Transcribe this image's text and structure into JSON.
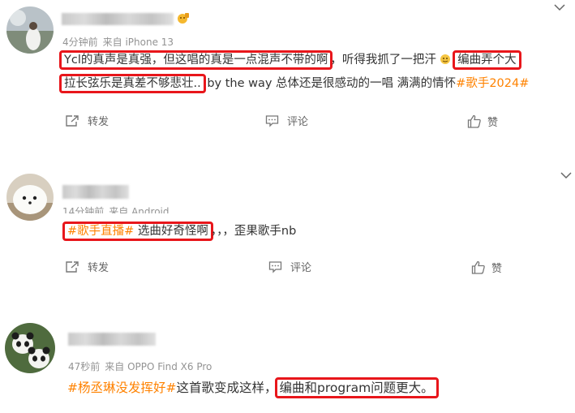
{
  "posts": [
    {
      "meta_time": "4分钟前",
      "meta_source": "来自 iPhone 13",
      "line1": {
        "hl1": "Ycl的真声是真强，但这唱的真是一点混声不带的啊",
        "mid": "，听得我抓了一把汗",
        "hl2": "编曲弄个大"
      },
      "line2": {
        "hl": "拉长弦乐是真差不够悲壮..",
        "rest": " by the way 总体还是很感动的一唱 满满的情怀",
        "tag": "#歌手2024#"
      },
      "actions": {
        "repost": "转发",
        "comment": "评论",
        "like": "赞"
      }
    },
    {
      "meta_time": "14分钟前",
      "meta_source": "来自 Android",
      "line1": {
        "tag": "#歌手直播#",
        "hl_rest": " 选曲好奇怪啊",
        "rest": "，，，歪果歌手nb"
      },
      "actions": {
        "repost": "转发",
        "comment": "评论",
        "like": "赞"
      }
    },
    {
      "meta_time": "47秒前",
      "meta_source": "来自 OPPO Find X6 Pro",
      "line1": {
        "tag": "#杨丞琳没发挥好#",
        "mid": "这首歌变成这样，",
        "hl": "编曲和program问题更大。"
      }
    }
  ],
  "colors": {
    "tag": "#ff8200",
    "highlight_border": "#e8161b",
    "meta": "#939393"
  },
  "icons": [
    "chevron-down-icon",
    "repost-icon",
    "comment-icon",
    "like-icon",
    "emoji-icon"
  ]
}
